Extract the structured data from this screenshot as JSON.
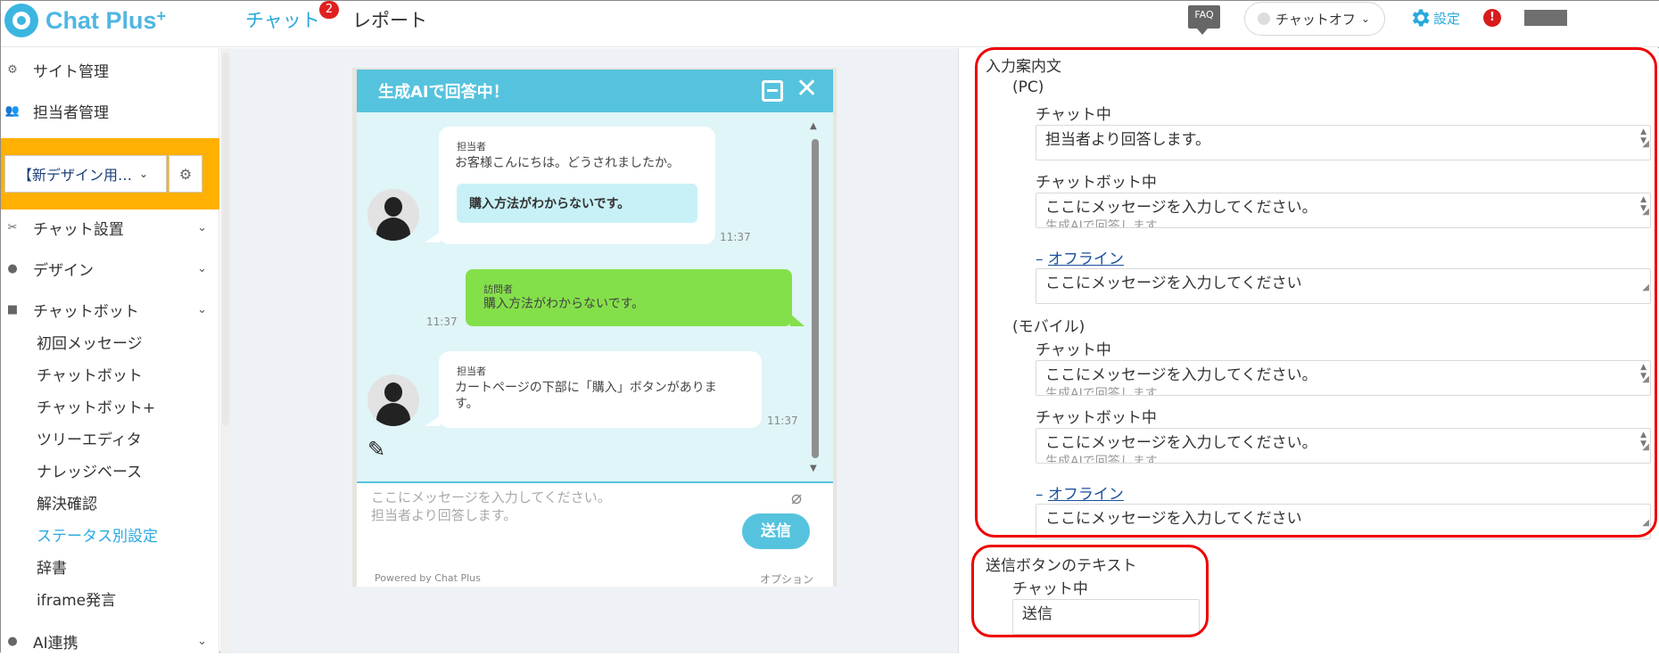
{
  "header": {
    "logo_text": "Chat Plus",
    "logo_plus": "+",
    "nav_chat": "チャット",
    "nav_chat_badge": "2",
    "nav_report": "レポート",
    "faq": "FAQ",
    "status_select": "チャットオフ",
    "settings": "設定",
    "alert": "!"
  },
  "sidebar": {
    "site_management": "サイト管理",
    "staff_management": "担当者管理",
    "site_select": "【新デザイン用…",
    "chat_setup": "チャット設置",
    "design": "デザイン",
    "chatbot": "チャットボット",
    "sub_items": [
      "初回メッセージ",
      "チャットボット",
      "チャットボット+",
      "ツリーエディタ",
      "ナレッジベース",
      "解決確認",
      "ステータス別設定",
      "辞書",
      "iframe発言"
    ],
    "active_sub": "ステータス別設定",
    "ai_integration": "AI連携"
  },
  "widget": {
    "header_title": "生成AIで回答中！",
    "messages": [
      {
        "sender": "担当者",
        "text": "お客様こんにちは。どうされましたか。",
        "quick_reply": "購入方法がわからないです。",
        "time": "11:37"
      },
      {
        "sender": "訪問者",
        "text": "購入方法がわからないです。",
        "time": "11:37"
      },
      {
        "sender": "担当者",
        "text_line1": "カートページの下部に「購入」ボタンがありま",
        "text_line2": "す。",
        "time": "11:37"
      }
    ],
    "placeholder_line1": "ここにメッセージを入力してください。",
    "placeholder_line2": "担当者より回答します。",
    "send_label": "送信",
    "powered": "Powered by Chat Plus",
    "option": "オプション"
  },
  "form": {
    "input_guide_label": "入力案内文",
    "pc_label": "(PC)",
    "pc_chatting_label": "チャット中",
    "pc_chatting_value": "担当者より回答します。",
    "pc_chatbot_label": "チャットボット中",
    "pc_chatbot_value": "ここにメッセージを入力してください。",
    "pc_chatbot_cut": "生成AIで回答します",
    "pc_offline_link": "オフライン",
    "pc_offline_value": "ここにメッセージを入力してください",
    "mobile_label": "(モバイル)",
    "mobile_chatting_label": "チャット中",
    "mobile_chatting_value": "ここにメッセージを入力してください。",
    "mobile_chatting_cut": "生成AIで回答します",
    "mobile_chatbot_label": "チャットボット中",
    "mobile_chatbot_value": "ここにメッセージを入力してください。",
    "mobile_chatbot_cut": "生成AIで回答します",
    "mobile_offline_link": "オフライン",
    "mobile_offline_value": "ここにメッセージを入力してください",
    "send_text_label": "送信ボタンのテキスト",
    "send_chatting_label": "チャット中",
    "send_chatting_value": "送信"
  },
  "colors": {
    "accent": "#29a9dc",
    "widget_header": "#56c3de",
    "visitor_bubble": "#84e04a",
    "site_box": "#ffb000",
    "highlight": "#e00000"
  }
}
